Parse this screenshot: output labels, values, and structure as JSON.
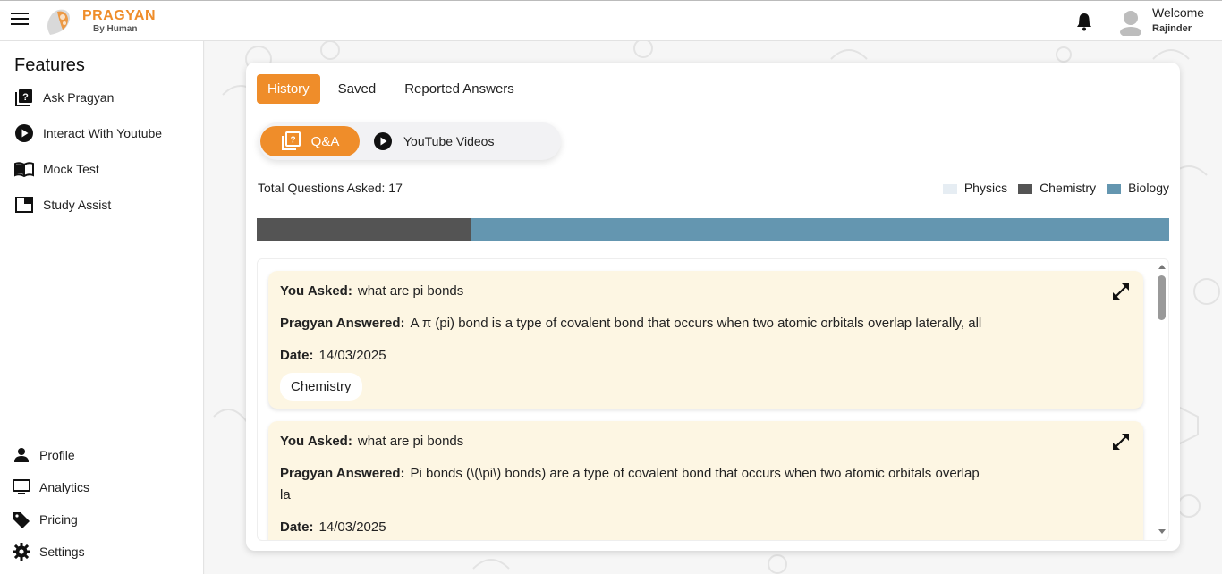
{
  "header": {
    "logo_title": "PRAGYAN",
    "logo_sub": "By Human",
    "welcome": "Welcome",
    "user": "Rajinder"
  },
  "sidebar": {
    "title": "Features",
    "items": [
      {
        "label": "Ask Pragyan",
        "icon": "question-book-icon"
      },
      {
        "label": "Interact With Youtube",
        "icon": "play-circle-icon"
      },
      {
        "label": "Mock Test",
        "icon": "open-book-icon"
      },
      {
        "label": "Study Assist",
        "icon": "window-icon"
      }
    ],
    "bottom_items": [
      {
        "label": "Profile",
        "icon": "person-icon"
      },
      {
        "label": "Analytics",
        "icon": "monitor-icon"
      },
      {
        "label": "Pricing",
        "icon": "tag-icon"
      },
      {
        "label": "Settings",
        "icon": "gear-icon"
      }
    ]
  },
  "tabs": [
    "History",
    "Saved",
    "Reported Answers"
  ],
  "toggle": {
    "qa": "Q&A",
    "youtube": "YouTube Videos"
  },
  "summary": {
    "total": "Total Questions Asked: 17"
  },
  "legend": [
    {
      "label": "Physics",
      "color": "#e6edf3"
    },
    {
      "label": "Chemistry",
      "color": "#545454"
    },
    {
      "label": "Biology",
      "color": "#6496b0"
    }
  ],
  "distribution": [
    {
      "subject": "Chemistry",
      "fraction": 0.235,
      "color": "#545454"
    },
    {
      "subject": "Biology",
      "fraction": 0.765,
      "color": "#6496b0"
    }
  ],
  "questions": [
    {
      "asked_label": "You Asked:",
      "asked": "what are pi bonds",
      "answer_label": "Pragyan Answered:",
      "answer": "A π (pi) bond is a type of covalent bond that occurs when two atomic orbitals overlap laterally, all",
      "date_label": "Date:",
      "date": "14/03/2025",
      "subject": "Chemistry"
    },
    {
      "asked_label": "You Asked:",
      "asked": "what are pi bonds",
      "answer_label": "Pragyan Answered:",
      "answer": "Pi bonds (\\(\\pi\\) bonds) are a type of covalent bond that occurs when two atomic orbitals overlap",
      "answer_cont": "la",
      "date_label": "Date:",
      "date": "14/03/2025"
    }
  ],
  "colors": {
    "accent": "#ef8d2a",
    "card_bg": "#fdf6e3"
  }
}
